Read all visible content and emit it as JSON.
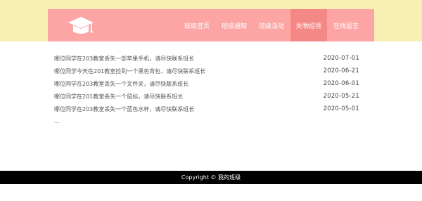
{
  "header": {
    "logo_icon": "graduation-cap-icon",
    "nav": [
      {
        "label": "班级首页",
        "active": false
      },
      {
        "label": "班级通知",
        "active": false
      },
      {
        "label": "班级活动",
        "active": false
      },
      {
        "label": "失物招领",
        "active": true
      },
      {
        "label": "在线留言",
        "active": false
      }
    ]
  },
  "lost_found": {
    "items": [
      {
        "title": "哪位同学在203教室丢失一部苹果手机，请尽快联系班长",
        "date": "2020-07-01"
      },
      {
        "title": "哪位同学今天在201教室捡到一个黑色背包，请尽快联系班长",
        "date": "2020-06-21"
      },
      {
        "title": "哪位同学在203教室丢失一个文件夹，请尽快联系班长",
        "date": "2020-06-01"
      },
      {
        "title": "哪位同学在201教室丢失一个鼠标，请尽快联系班长",
        "date": "2020-05-21"
      },
      {
        "title": "哪位同学在203教室丢失一个蓝色水杯，请尽快联系班长",
        "date": "2020-05-01"
      }
    ],
    "more": "..."
  },
  "footer": {
    "text": "Copyright © 我的班级"
  },
  "colors": {
    "top_band": "#f9efb5",
    "header": "#fca5a4",
    "active_nav": "#f48886",
    "footer": "#000000"
  }
}
